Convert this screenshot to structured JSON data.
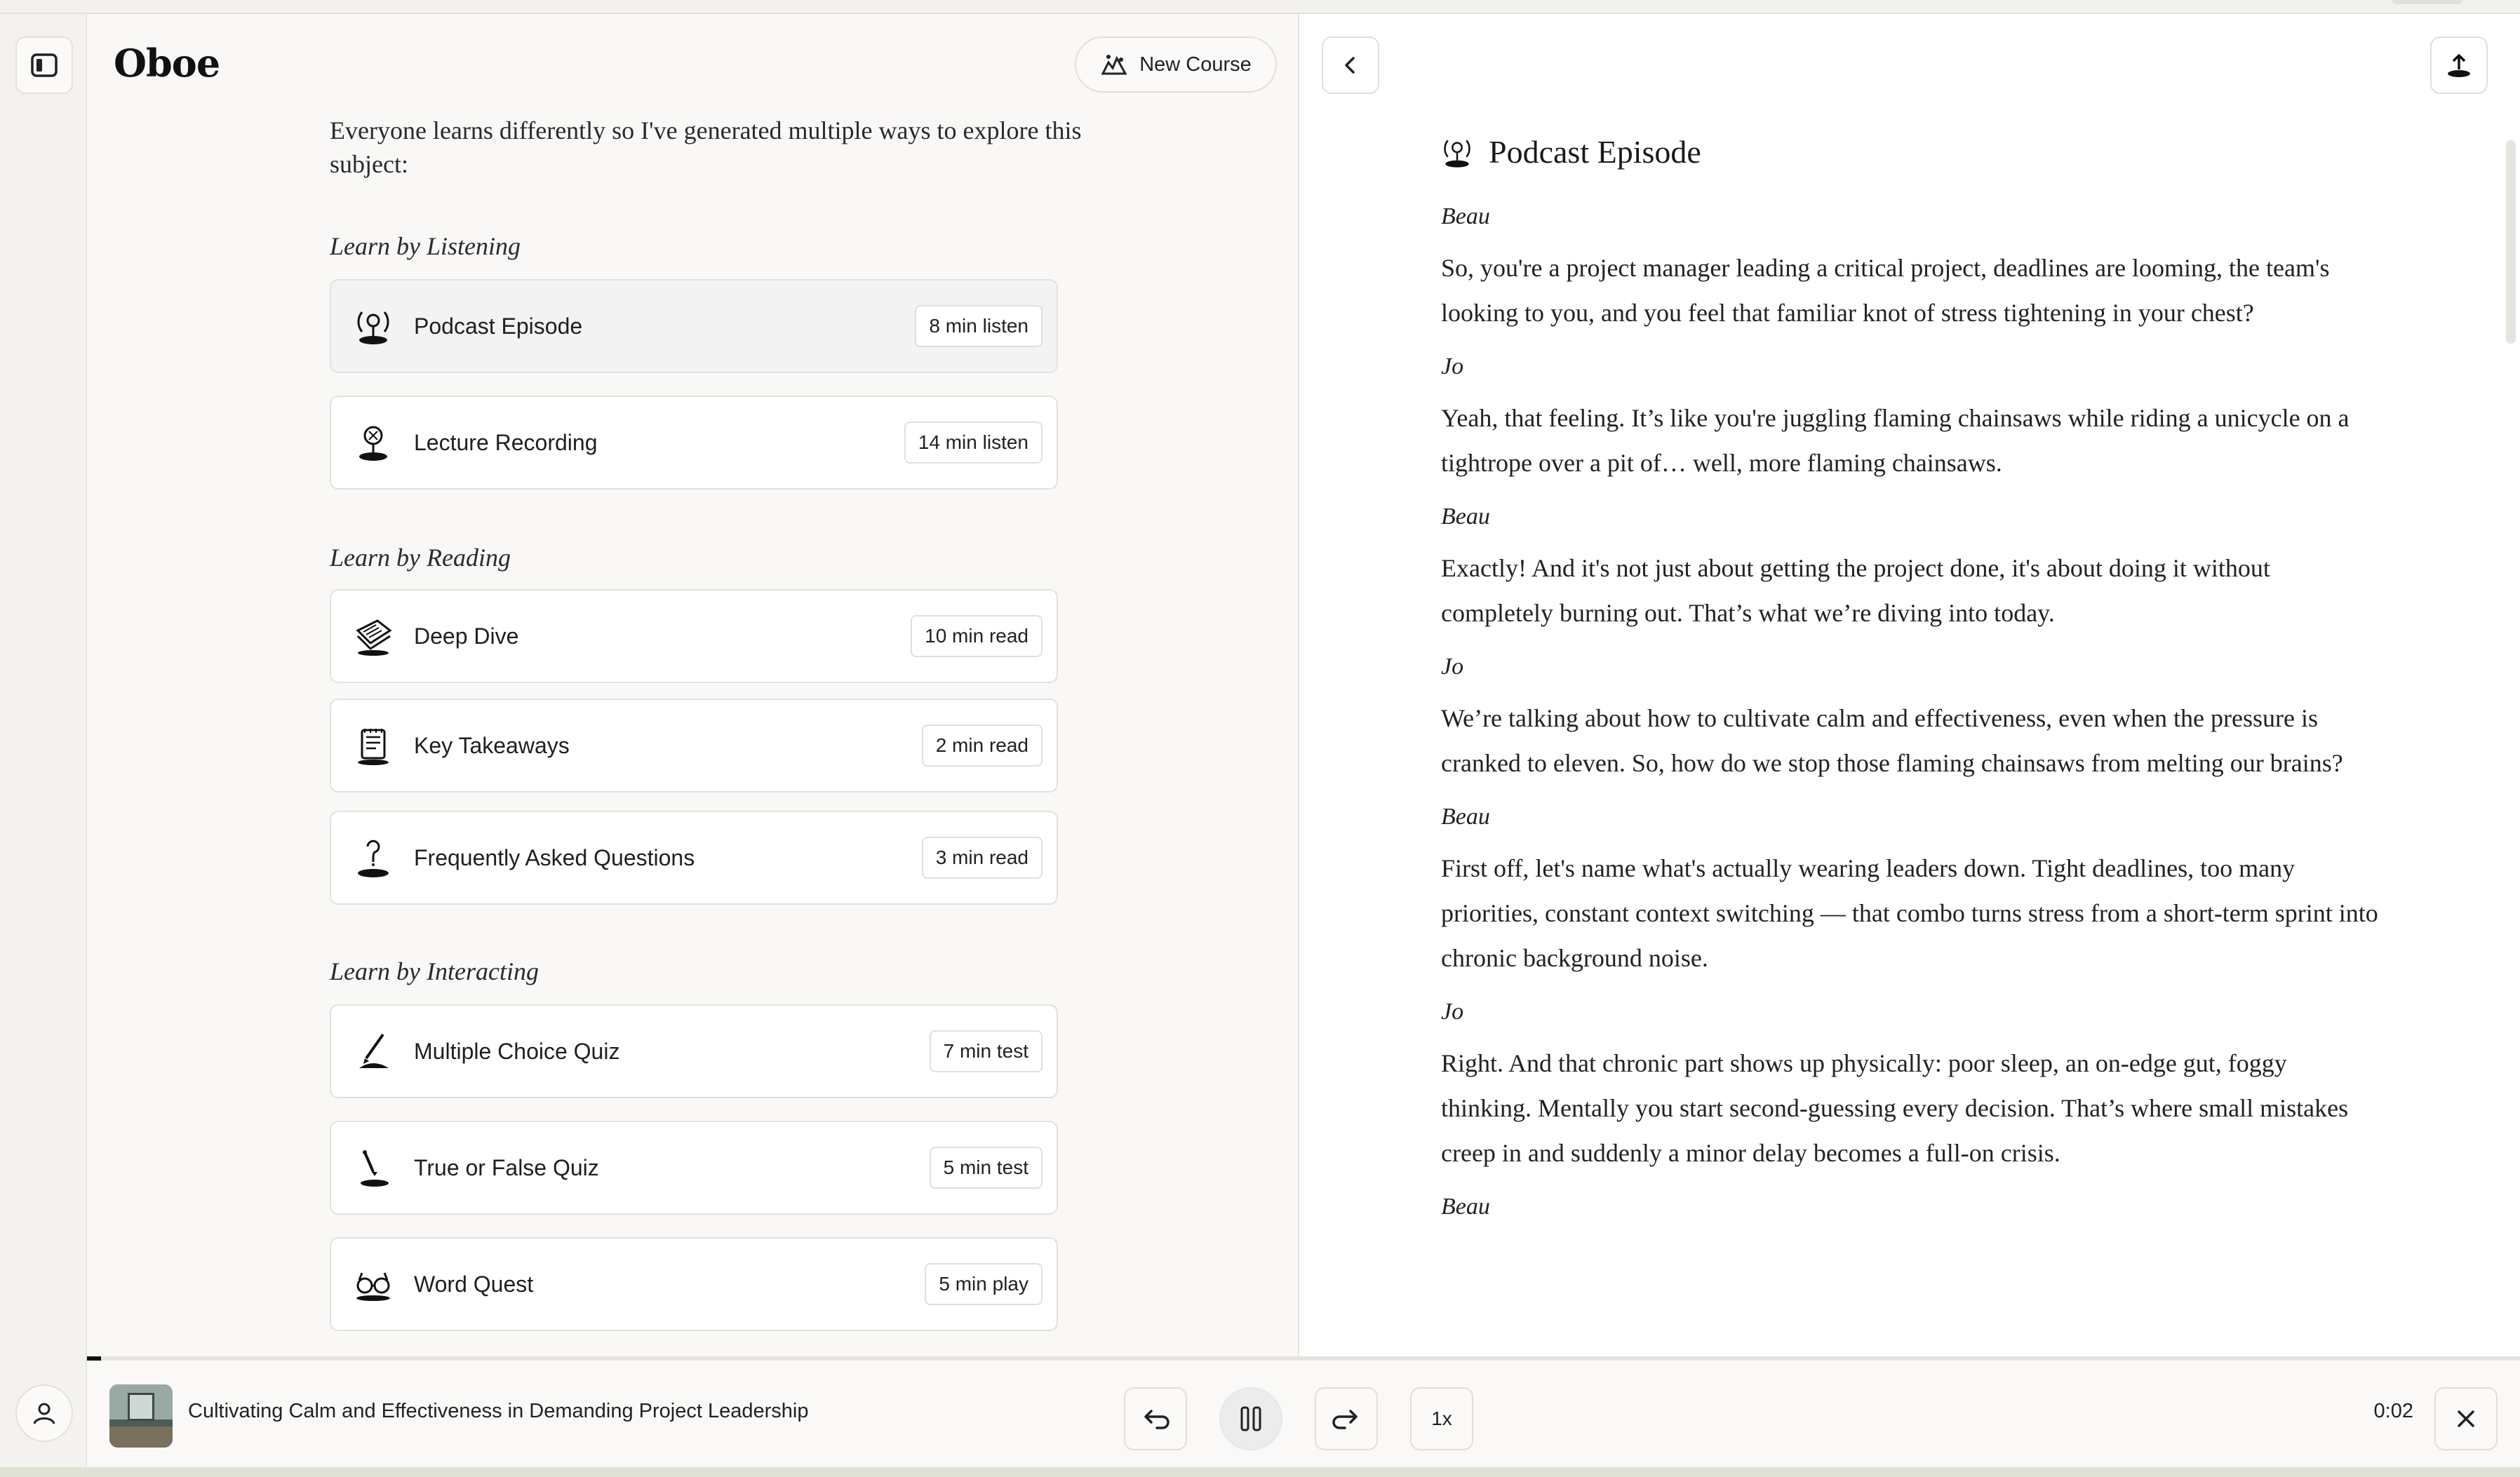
{
  "app": {
    "name": "Oboe"
  },
  "header": {
    "new_course_label": "New Course"
  },
  "intro_text": "Everyone learns differently so I've generated multiple ways to explore this subject:",
  "sections": [
    {
      "title": "Learn by Listening"
    },
    {
      "title": "Learn by Reading"
    },
    {
      "title": "Learn by Interacting"
    }
  ],
  "items": [
    {
      "label": "Podcast Episode",
      "badge": "8 min listen",
      "icon": "podcast-icon",
      "active": true
    },
    {
      "label": "Lecture Recording",
      "badge": "14 min listen",
      "icon": "lecture-icon"
    },
    {
      "label": "Deep Dive",
      "badge": "10 min read",
      "icon": "book-icon"
    },
    {
      "label": "Key Takeaways",
      "badge": "2 min read",
      "icon": "notepad-icon"
    },
    {
      "label": "Frequently Asked Questions",
      "badge": "3 min read",
      "icon": "question-icon"
    },
    {
      "label": "Multiple Choice Quiz",
      "badge": "7 min test",
      "icon": "quiz-pen-icon"
    },
    {
      "label": "True or False Quiz",
      "badge": "5 min test",
      "icon": "pencil-icon"
    },
    {
      "label": "Word Quest",
      "badge": "5 min play",
      "icon": "glasses-icon"
    }
  ],
  "episode": {
    "title": "Podcast Episode",
    "transcript": [
      {
        "speaker": "Beau",
        "text": "So, you're a project manager leading a critical project, deadlines are looming, the team's looking to you, and you feel that familiar knot of stress tightening in your chest?"
      },
      {
        "speaker": "Jo",
        "text": "Yeah, that feeling. It’s like you're juggling flaming chainsaws while riding a unicycle on a tightrope over a pit of… well, more flaming chainsaws."
      },
      {
        "speaker": "Beau",
        "text": "Exactly! And it's not just about getting the project done, it's about doing it without completely burning out. That’s what we’re diving into today."
      },
      {
        "speaker": "Jo",
        "text": "We’re talking about how to cultivate calm and effectiveness, even when the pressure is cranked to eleven. So, how do we stop those flaming chainsaws from melting our brains?"
      },
      {
        "speaker": "Beau",
        "text": "First off, let's name what's actually wearing leaders down. Tight deadlines, too many priorities, constant context switching — that combo turns stress from a short-term sprint into chronic background noise."
      },
      {
        "speaker": "Jo",
        "text": "Right. And that chronic part shows up physically: poor sleep, an on-edge gut, foggy thinking. Mentally you start second-guessing every decision. That’s where small mistakes creep in and suddenly a minor delay becomes a full-on crisis."
      },
      {
        "speaker": "Beau",
        "text": ""
      }
    ]
  },
  "player": {
    "title": "Cultivating Calm and Effectiveness in Demanding Project Leadership",
    "speed": "1x",
    "time": "0:02",
    "progress_fraction": 0.003
  }
}
